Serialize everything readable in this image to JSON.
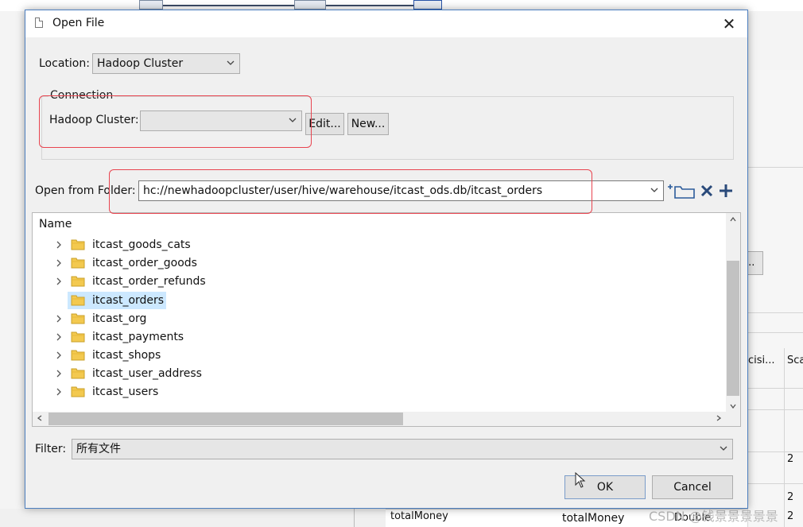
{
  "dialog": {
    "title": "Open File",
    "close_glyph": "✕",
    "location": {
      "label": "Location:",
      "value": "Hadoop Cluster"
    },
    "connection": {
      "group_title": "Connection",
      "label": "Hadoop Cluster:",
      "value": "",
      "edit_button": "Edit...",
      "new_button": "New..."
    },
    "open_from": {
      "label": "Open from Folder:",
      "value": "hc://newhadoopcluster/user/hive/warehouse/itcast_ods.db/itcast_orders"
    },
    "tree": {
      "header": "Name",
      "items": [
        {
          "label": "itcast_goods_cats",
          "expandable": true,
          "selected": false
        },
        {
          "label": "itcast_order_goods",
          "expandable": true,
          "selected": false
        },
        {
          "label": "itcast_order_refunds",
          "expandable": true,
          "selected": false
        },
        {
          "label": "itcast_orders",
          "expandable": false,
          "selected": true
        },
        {
          "label": "itcast_org",
          "expandable": true,
          "selected": false
        },
        {
          "label": "itcast_payments",
          "expandable": true,
          "selected": false
        },
        {
          "label": "itcast_shops",
          "expandable": true,
          "selected": false
        },
        {
          "label": "itcast_user_address",
          "expandable": true,
          "selected": false
        },
        {
          "label": "itcast_users",
          "expandable": true,
          "selected": false
        }
      ]
    },
    "filter": {
      "label": "Filter:",
      "value": "所有文件"
    },
    "ok_button": "OK",
    "cancel_button": "Cancel"
  },
  "background": {
    "right_button_label": "...",
    "col_header_1": "cisi...",
    "col_header_2": "Sca",
    "value_a": "2",
    "value_b": "2",
    "value_c": "2",
    "bottom_cell_1": "totalMoney",
    "bottom_cell_2": "totalMoney",
    "bottom_cell_3": "Double",
    "watermark": "CSDN @钱景景景景景"
  },
  "colors": {
    "highlight": "#e8444f",
    "selection": "#cce8ff",
    "folder": "#f3c94f",
    "dialog_border": "#4d7fbf"
  },
  "icons": {
    "new_folder": "new-folder-icon",
    "delete": "delete-icon",
    "add": "add-icon"
  }
}
